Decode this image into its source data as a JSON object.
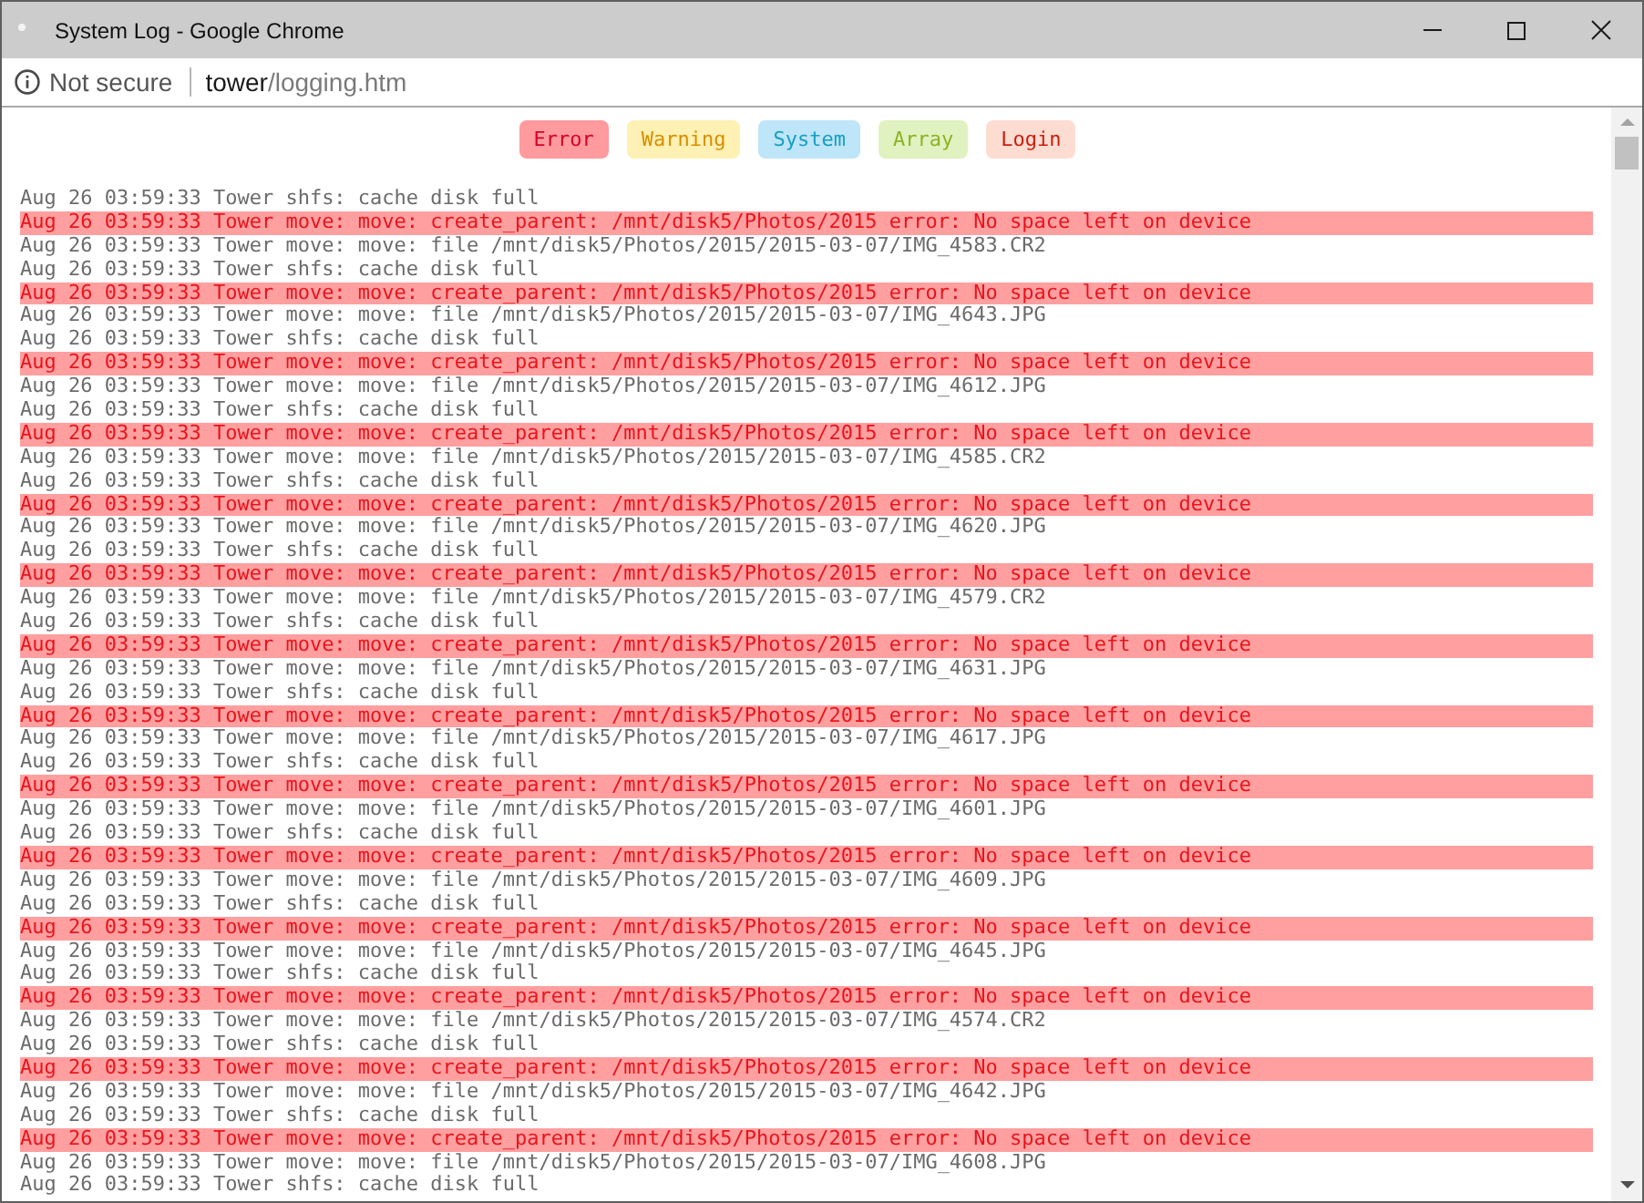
{
  "window": {
    "title": "System Log - Google Chrome"
  },
  "address_bar": {
    "security": "Not secure",
    "host": "tower",
    "path": "/logging.htm"
  },
  "filters": [
    {
      "label": "Error",
      "color": "#ff9a9e"
    },
    {
      "label": "Warning",
      "color": "#fff0b3"
    },
    {
      "label": "System",
      "color": "#bee5f8"
    },
    {
      "label": "Array",
      "color": "#dff2c0"
    },
    {
      "label": "Login",
      "color": "#fddcd2"
    }
  ],
  "log": [
    {
      "kind": "info",
      "text": "Aug 26 03:59:33 Tower shfs: cache disk full"
    },
    {
      "kind": "error",
      "text": "Aug 26 03:59:33 Tower move: move: create_parent: /mnt/disk5/Photos/2015 error: No space left on device"
    },
    {
      "kind": "info",
      "text": "Aug 26 03:59:33 Tower move: move: file /mnt/disk5/Photos/2015/2015-03-07/IMG_4583.CR2"
    },
    {
      "kind": "info",
      "text": "Aug 26 03:59:33 Tower shfs: cache disk full"
    },
    {
      "kind": "error",
      "text": "Aug 26 03:59:33 Tower move: move: create_parent: /mnt/disk5/Photos/2015 error: No space left on device"
    },
    {
      "kind": "info",
      "text": "Aug 26 03:59:33 Tower move: move: file /mnt/disk5/Photos/2015/2015-03-07/IMG_4643.JPG"
    },
    {
      "kind": "info",
      "text": "Aug 26 03:59:33 Tower shfs: cache disk full"
    },
    {
      "kind": "error",
      "text": "Aug 26 03:59:33 Tower move: move: create_parent: /mnt/disk5/Photos/2015 error: No space left on device"
    },
    {
      "kind": "info",
      "text": "Aug 26 03:59:33 Tower move: move: file /mnt/disk5/Photos/2015/2015-03-07/IMG_4612.JPG"
    },
    {
      "kind": "info",
      "text": "Aug 26 03:59:33 Tower shfs: cache disk full"
    },
    {
      "kind": "error",
      "text": "Aug 26 03:59:33 Tower move: move: create_parent: /mnt/disk5/Photos/2015 error: No space left on device"
    },
    {
      "kind": "info",
      "text": "Aug 26 03:59:33 Tower move: move: file /mnt/disk5/Photos/2015/2015-03-07/IMG_4585.CR2"
    },
    {
      "kind": "info",
      "text": "Aug 26 03:59:33 Tower shfs: cache disk full"
    },
    {
      "kind": "error",
      "text": "Aug 26 03:59:33 Tower move: move: create_parent: /mnt/disk5/Photos/2015 error: No space left on device"
    },
    {
      "kind": "info",
      "text": "Aug 26 03:59:33 Tower move: move: file /mnt/disk5/Photos/2015/2015-03-07/IMG_4620.JPG"
    },
    {
      "kind": "info",
      "text": "Aug 26 03:59:33 Tower shfs: cache disk full"
    },
    {
      "kind": "error",
      "text": "Aug 26 03:59:33 Tower move: move: create_parent: /mnt/disk5/Photos/2015 error: No space left on device"
    },
    {
      "kind": "info",
      "text": "Aug 26 03:59:33 Tower move: move: file /mnt/disk5/Photos/2015/2015-03-07/IMG_4579.CR2"
    },
    {
      "kind": "info",
      "text": "Aug 26 03:59:33 Tower shfs: cache disk full"
    },
    {
      "kind": "error",
      "text": "Aug 26 03:59:33 Tower move: move: create_parent: /mnt/disk5/Photos/2015 error: No space left on device"
    },
    {
      "kind": "info",
      "text": "Aug 26 03:59:33 Tower move: move: file /mnt/disk5/Photos/2015/2015-03-07/IMG_4631.JPG"
    },
    {
      "kind": "info",
      "text": "Aug 26 03:59:33 Tower shfs: cache disk full"
    },
    {
      "kind": "error",
      "text": "Aug 26 03:59:33 Tower move: move: create_parent: /mnt/disk5/Photos/2015 error: No space left on device"
    },
    {
      "kind": "info",
      "text": "Aug 26 03:59:33 Tower move: move: file /mnt/disk5/Photos/2015/2015-03-07/IMG_4617.JPG"
    },
    {
      "kind": "info",
      "text": "Aug 26 03:59:33 Tower shfs: cache disk full"
    },
    {
      "kind": "error",
      "text": "Aug 26 03:59:33 Tower move: move: create_parent: /mnt/disk5/Photos/2015 error: No space left on device"
    },
    {
      "kind": "info",
      "text": "Aug 26 03:59:33 Tower move: move: file /mnt/disk5/Photos/2015/2015-03-07/IMG_4601.JPG"
    },
    {
      "kind": "info",
      "text": "Aug 26 03:59:33 Tower shfs: cache disk full"
    },
    {
      "kind": "error",
      "text": "Aug 26 03:59:33 Tower move: move: create_parent: /mnt/disk5/Photos/2015 error: No space left on device"
    },
    {
      "kind": "info",
      "text": "Aug 26 03:59:33 Tower move: move: file /mnt/disk5/Photos/2015/2015-03-07/IMG_4609.JPG"
    },
    {
      "kind": "info",
      "text": "Aug 26 03:59:33 Tower shfs: cache disk full"
    },
    {
      "kind": "error",
      "text": "Aug 26 03:59:33 Tower move: move: create_parent: /mnt/disk5/Photos/2015 error: No space left on device"
    },
    {
      "kind": "info",
      "text": "Aug 26 03:59:33 Tower move: move: file /mnt/disk5/Photos/2015/2015-03-07/IMG_4645.JPG"
    },
    {
      "kind": "info",
      "text": "Aug 26 03:59:33 Tower shfs: cache disk full"
    },
    {
      "kind": "error",
      "text": "Aug 26 03:59:33 Tower move: move: create_parent: /mnt/disk5/Photos/2015 error: No space left on device"
    },
    {
      "kind": "info",
      "text": "Aug 26 03:59:33 Tower move: move: file /mnt/disk5/Photos/2015/2015-03-07/IMG_4574.CR2"
    },
    {
      "kind": "info",
      "text": "Aug 26 03:59:33 Tower shfs: cache disk full"
    },
    {
      "kind": "error",
      "text": "Aug 26 03:59:33 Tower move: move: create_parent: /mnt/disk5/Photos/2015 error: No space left on device"
    },
    {
      "kind": "info",
      "text": "Aug 26 03:59:33 Tower move: move: file /mnt/disk5/Photos/2015/2015-03-07/IMG_4642.JPG"
    },
    {
      "kind": "info",
      "text": "Aug 26 03:59:33 Tower shfs: cache disk full"
    },
    {
      "kind": "error",
      "text": "Aug 26 03:59:33 Tower move: move: create_parent: /mnt/disk5/Photos/2015 error: No space left on device"
    },
    {
      "kind": "info",
      "text": "Aug 26 03:59:33 Tower move: move: file /mnt/disk5/Photos/2015/2015-03-07/IMG_4608.JPG"
    },
    {
      "kind": "info",
      "text": "Aug 26 03:59:33 Tower shfs: cache disk full"
    }
  ]
}
